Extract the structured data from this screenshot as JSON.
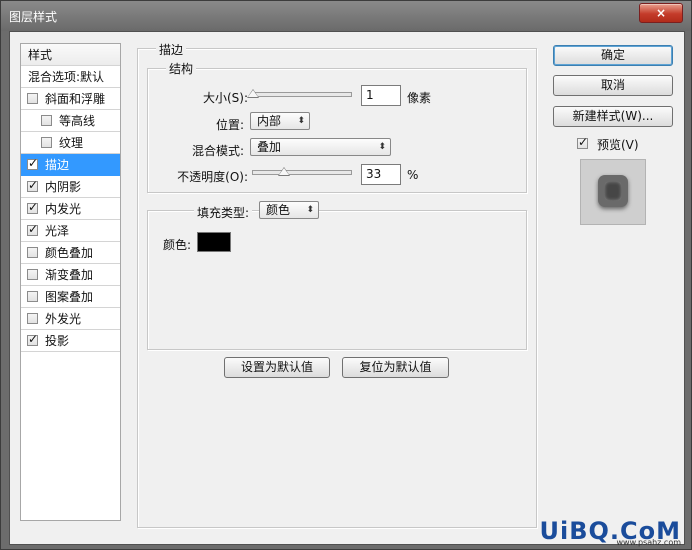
{
  "window": {
    "title": "图层样式",
    "close_label": "×"
  },
  "style_list": {
    "header": "样式",
    "blend_options": "混合选项:默认",
    "items": [
      {
        "label": "斜面和浮雕",
        "checked": false,
        "indent": false,
        "selected": false
      },
      {
        "label": "等高线",
        "checked": false,
        "indent": true,
        "selected": false
      },
      {
        "label": "纹理",
        "checked": false,
        "indent": true,
        "selected": false
      },
      {
        "label": "描边",
        "checked": true,
        "indent": false,
        "selected": true
      },
      {
        "label": "内阴影",
        "checked": true,
        "indent": false,
        "selected": false
      },
      {
        "label": "内发光",
        "checked": true,
        "indent": false,
        "selected": false
      },
      {
        "label": "光泽",
        "checked": true,
        "indent": false,
        "selected": false
      },
      {
        "label": "颜色叠加",
        "checked": false,
        "indent": false,
        "selected": false
      },
      {
        "label": "渐变叠加",
        "checked": false,
        "indent": false,
        "selected": false
      },
      {
        "label": "图案叠加",
        "checked": false,
        "indent": false,
        "selected": false
      },
      {
        "label": "外发光",
        "checked": false,
        "indent": false,
        "selected": false
      },
      {
        "label": "投影",
        "checked": true,
        "indent": false,
        "selected": false
      }
    ]
  },
  "stroke": {
    "section_title": "描边",
    "structure_title": "结构",
    "size_label": "大小(S):",
    "size_value": "1",
    "size_unit": "像素",
    "position_label": "位置:",
    "position_value": "内部",
    "blend_label": "混合模式:",
    "blend_value": "叠加",
    "opacity_label": "不透明度(O):",
    "opacity_value": "33",
    "opacity_unit": "%",
    "size_fraction": 0.01,
    "opacity_fraction": 0.33,
    "fill_type_label": "填充类型:",
    "fill_type_value": "颜色",
    "color_label": "颜色:",
    "color": "#000000"
  },
  "actions": {
    "set_default": "设置为默认值",
    "reset_default": "复位为默认值",
    "ok": "确定",
    "cancel": "取消",
    "new_style": "新建样式(W)...",
    "preview_label": "预览(V)",
    "preview_checked": true
  },
  "watermark": {
    "text": "UiBQ.CoM",
    "url": "www.psahz.com"
  }
}
